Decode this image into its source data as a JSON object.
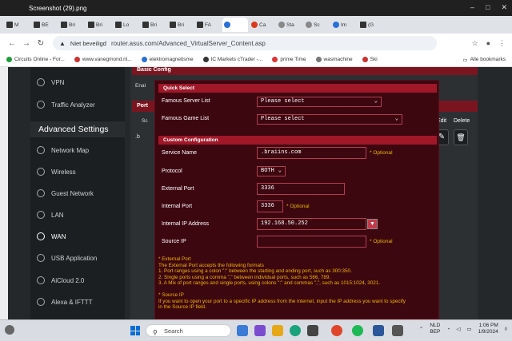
{
  "viewer": {
    "title": "Screenshot (29).png"
  },
  "tabs": [
    {
      "label": "M"
    },
    {
      "label": "BE"
    },
    {
      "label": "Bri"
    },
    {
      "label": "Bri"
    },
    {
      "label": "Lo"
    },
    {
      "label": "Bri"
    },
    {
      "label": "Bri"
    },
    {
      "label": "FA"
    },
    {
      "label": ""
    },
    {
      "label": "Ca"
    },
    {
      "label": "Sta"
    },
    {
      "label": "Sc"
    },
    {
      "label": "Im"
    },
    {
      "label": "(G"
    }
  ],
  "addressbar": {
    "security": "Niet beveiligd",
    "url": "router.asus.com/Advanced_VirtualServer_Content.asp"
  },
  "bookmarks": [
    "Circuits Online - For...",
    "www.vanegmond.nl...",
    "elektromagnetisme",
    "IC Markets cTrader -...",
    "prime Time",
    "wasmachine",
    "Ski"
  ],
  "bookmarks_all": "Alle bookmarks",
  "sidebar": {
    "vpn": "VPN",
    "traffic": "Traffic Analyzer",
    "advanced": "Advanced Settings",
    "items": [
      "Network Map",
      "Wireless",
      "Guest Network",
      "LAN",
      "WAN",
      "USB Application",
      "AiCloud 2.0",
      "Alexa & IFTTT"
    ]
  },
  "background": {
    "basic_config": "Basic Config",
    "enable_prefix": "Enal",
    "port_prefix": "Port",
    "sc_prefix": "Sc",
    "row_prefix": ".b",
    "edit": "Edit",
    "delete": "Delete"
  },
  "modal": {
    "quick_select": "Quick Select",
    "famous_server_label": "Famous Server List",
    "famous_server_value": "Please select",
    "famous_game_label": "Famous Game List",
    "famous_game_value": "Please select",
    "custom_config": "Custom Configuration",
    "service_name_label": "Service Name",
    "service_name_value": ".braiins.com",
    "optional": "* Optional",
    "protocol_label": "Protocol",
    "protocol_value": "BOTH",
    "external_port_label": "External Port",
    "external_port_value": "3336",
    "internal_port_label": "Internal Port",
    "internal_port_value": "3336",
    "internal_ip_label": "Internal IP Address",
    "internal_ip_value": "192.168.50.252",
    "source_ip_label": "Source IP",
    "source_ip_value": "",
    "notes": [
      "* External Port",
      "The External Port accepts the following formats",
      "1. Port ranges using a colon \":\" between the starting and ending port, such as 300:350.",
      "2. Single ports using a comma \",\" between individual ports, such as 566, 789.",
      "3. A Mix of port ranges and single ports, using colons \":\" and commas \",\", such as 1015:1024, 3021.",
      "",
      "* Source IP",
      "If you want to open your port to a specific IP address from the internet, input the IP address you want to specify",
      "in the Source IP field."
    ]
  },
  "taskbar": {
    "search_placeholder": "Search",
    "lang_top": "NLD",
    "lang_bottom": "BEP",
    "time": "1:06 PM",
    "date": "1/9/2024"
  }
}
